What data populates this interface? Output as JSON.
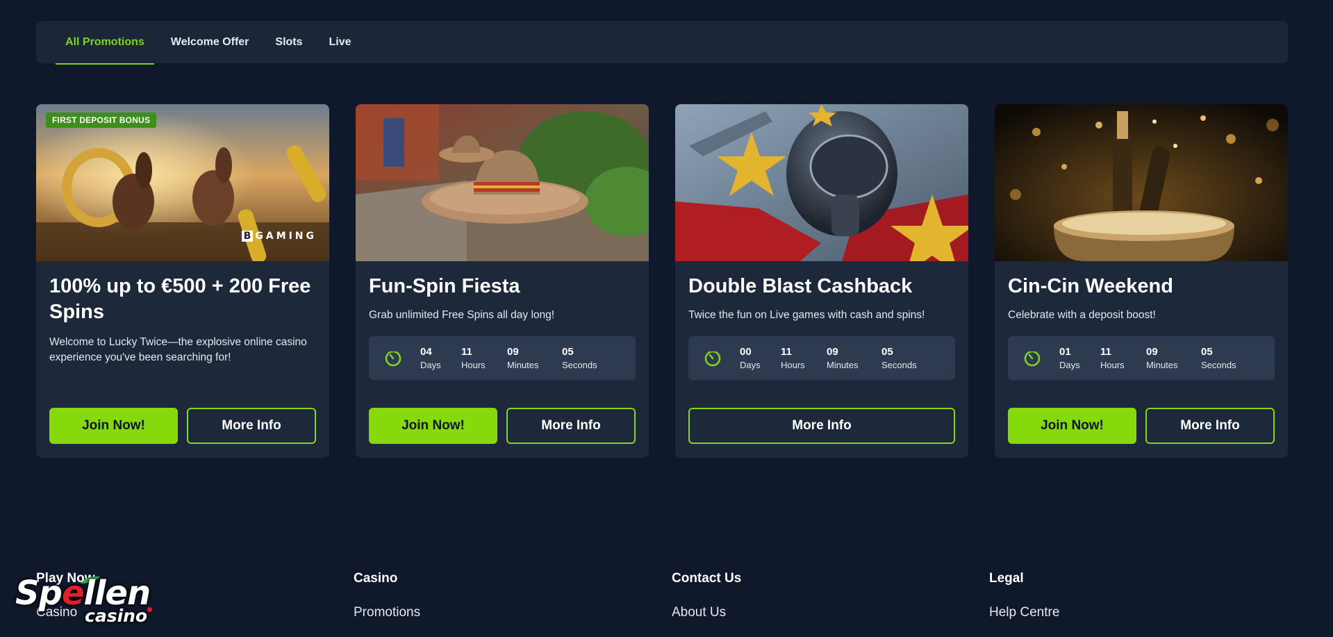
{
  "tabs": [
    {
      "label": "All Promotions",
      "active": true
    },
    {
      "label": "Welcome Offer",
      "active": false
    },
    {
      "label": "Slots",
      "active": false
    },
    {
      "label": "Live",
      "active": false
    }
  ],
  "cards": [
    {
      "badge": "FIRST DEPOSIT BONUS",
      "provider_logo": {
        "mark": "B",
        "text": "GAMING"
      },
      "title": "100% up to €500 + 200 Free Spins",
      "description": "Welcome to Lucky Twice—the explosive online casino experience you've been searching for!",
      "join_label": "Join Now!",
      "more_label": "More Info"
    },
    {
      "title": "Fun-Spin Fiesta",
      "description": "Grab unlimited Free Spins all day long!",
      "countdown": {
        "days": "04",
        "hours": "11",
        "minutes": "09",
        "seconds": "05"
      },
      "join_label": "Join Now!",
      "more_label": "More Info"
    },
    {
      "title": "Double Blast Cashback",
      "description": "Twice the fun on Live games with cash and spins!",
      "countdown": {
        "days": "00",
        "hours": "11",
        "minutes": "09",
        "seconds": "05"
      },
      "more_label": "More Info"
    },
    {
      "title": "Cin-Cin Weekend",
      "description": "Celebrate with a deposit boost!",
      "countdown": {
        "days": "01",
        "hours": "11",
        "minutes": "09",
        "seconds": "05"
      },
      "join_label": "Join Now!",
      "more_label": "More Info"
    }
  ],
  "countdown_labels": {
    "days": "Days",
    "hours": "Hours",
    "minutes": "Minutes",
    "seconds": "Seconds"
  },
  "footer": {
    "columns": [
      {
        "heading": "Play Now",
        "link": "Casino"
      },
      {
        "heading": "Casino",
        "link": "Promotions"
      },
      {
        "heading": "Contact Us",
        "link": "About Us"
      },
      {
        "heading": "Legal",
        "link": "Help Centre"
      }
    ]
  },
  "brand": {
    "word_pre": "Sp",
    "word_e": "e",
    "word_post": "llen",
    "sub": "casino"
  },
  "colors": {
    "accent": "#86d90a",
    "background": "#10182b",
    "card": "#1d283b",
    "brand_red": "#e11e2a"
  }
}
